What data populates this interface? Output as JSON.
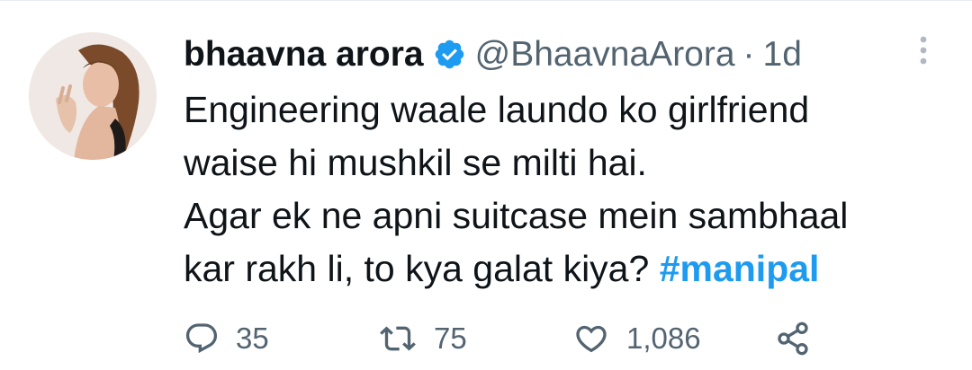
{
  "tweet": {
    "author": {
      "display_name": "bhaavna arora",
      "handle": "@BhaavnaArora",
      "verified": true
    },
    "separator": "·",
    "time": "1d",
    "text_lines": [
      "Engineering waale laundo ko girlfriend",
      "waise hi mushkil se milti hai.",
      "Agar ek ne apni suitcase mein sambhaal",
      "kar rakh li, to kya galat kiya?"
    ],
    "hashtag": "#manipal",
    "stats": {
      "replies": "35",
      "retweets": "75",
      "likes": "1,086"
    }
  },
  "colors": {
    "text": "#0f1419",
    "secondary": "#536471",
    "accent": "#1d9bf0"
  },
  "icons": [
    "verified-badge-icon",
    "more-options-icon",
    "reply-icon",
    "retweet-icon",
    "like-icon",
    "share-icon"
  ]
}
